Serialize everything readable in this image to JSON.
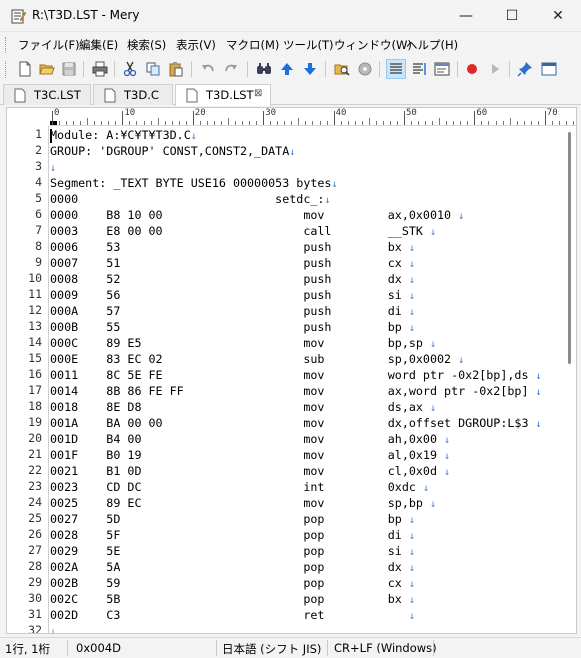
{
  "window": {
    "title": "R:\\T3D.LST - Mery",
    "minimize_glyph": "—",
    "maximize_glyph": "☐",
    "close_glyph": "✕"
  },
  "menu": [
    {
      "label": "ファイル(F)"
    },
    {
      "label": "編集(E)"
    },
    {
      "label": "検索(S)"
    },
    {
      "label": "表示(V)"
    },
    {
      "label": "マクロ(M)"
    },
    {
      "label": "ツール(T)"
    },
    {
      "label": "ウィンドウ(W)"
    },
    {
      "label": "ヘルプ(H)"
    }
  ],
  "toolbar": {
    "icons": [
      "new-file-icon",
      "open-folder-icon",
      "save-icon",
      "print-icon",
      "cut-icon",
      "copy-icon",
      "paste-icon",
      "undo-icon",
      "redo-icon",
      "find-icon",
      "find-up-icon",
      "find-down-icon",
      "search-files-icon",
      "disc-icon",
      "wrap-none-icon",
      "wrap-window-icon",
      "wrap-column-icon",
      "record-macro-icon",
      "run-macro-icon",
      "pin-icon",
      "window-icon"
    ]
  },
  "tabs": [
    {
      "label": "T3C.LST",
      "active": false
    },
    {
      "label": "T3D.C",
      "active": false
    },
    {
      "label": "T3D.LST",
      "active": true,
      "close_glyph": "⊠"
    }
  ],
  "ruler": {
    "labels": [
      "0",
      "10",
      "20",
      "30",
      "40",
      "50",
      "60",
      "70"
    ]
  },
  "editor": {
    "eol_glyph": "↓",
    "lines": [
      {
        "num": "1",
        "text": "Module: A:¥C¥T¥T3D.C",
        "eol": true
      },
      {
        "num": "2",
        "text": "GROUP: 'DGROUP' CONST,CONST2,_DATA",
        "eol": true
      },
      {
        "num": "3",
        "text": "",
        "eol": true
      },
      {
        "num": "4",
        "text": "Segment: _TEXT BYTE USE16 00000053 bytes",
        "eol": true
      },
      {
        "num": "5",
        "text": "0000                            setdc_:",
        "eol": true
      },
      {
        "num": "6",
        "text": "0000    B8 10 00                    mov         ax,0x0010 ",
        "eol": true
      },
      {
        "num": "7",
        "text": "0003    E8 00 00                    call        __STK ",
        "eol": true
      },
      {
        "num": "8",
        "text": "0006    53                          push        bx ",
        "eol": true
      },
      {
        "num": "9",
        "text": "0007    51                          push        cx ",
        "eol": true
      },
      {
        "num": "10",
        "text": "0008    52                          push        dx ",
        "eol": true
      },
      {
        "num": "11",
        "text": "0009    56                          push        si ",
        "eol": true
      },
      {
        "num": "12",
        "text": "000A    57                          push        di ",
        "eol": true
      },
      {
        "num": "13",
        "text": "000B    55                          push        bp ",
        "eol": true
      },
      {
        "num": "14",
        "text": "000C    89 E5                       mov         bp,sp ",
        "eol": true
      },
      {
        "num": "15",
        "text": "000E    83 EC 02                    sub         sp,0x0002 ",
        "eol": true
      },
      {
        "num": "16",
        "text": "0011    8C 5E FE                    mov         word ptr -0x2[bp],ds ",
        "eol": true
      },
      {
        "num": "17",
        "text": "0014    8B 86 FE FF                 mov         ax,word ptr -0x2[bp] ",
        "eol": true
      },
      {
        "num": "18",
        "text": "0018    8E D8                       mov         ds,ax ",
        "eol": true
      },
      {
        "num": "19",
        "text": "001A    BA 00 00                    mov         dx,offset DGROUP:L$3 ",
        "eol": true
      },
      {
        "num": "20",
        "text": "001D    B4 00                       mov         ah,0x00 ",
        "eol": true
      },
      {
        "num": "21",
        "text": "001F    B0 19                       mov         al,0x19 ",
        "eol": true
      },
      {
        "num": "22",
        "text": "0021    B1 0D                       mov         cl,0x0d ",
        "eol": true
      },
      {
        "num": "23",
        "text": "0023    CD DC                       int         0xdc ",
        "eol": true
      },
      {
        "num": "24",
        "text": "0025    89 EC                       mov         sp,bp ",
        "eol": true
      },
      {
        "num": "25",
        "text": "0027    5D                          pop         bp ",
        "eol": true
      },
      {
        "num": "26",
        "text": "0028    5F                          pop         di ",
        "eol": true
      },
      {
        "num": "27",
        "text": "0029    5E                          pop         si ",
        "eol": true
      },
      {
        "num": "28",
        "text": "002A    5A                          pop         dx ",
        "eol": true
      },
      {
        "num": "29",
        "text": "002B    59                          pop         cx ",
        "eol": true
      },
      {
        "num": "30",
        "text": "002C    5B                          pop         bx ",
        "eol": true
      },
      {
        "num": "31",
        "text": "002D    C3                          ret            ",
        "eol": true
      },
      {
        "num": "32",
        "text": "",
        "eol": true
      }
    ]
  },
  "status": {
    "position": "1行, 1桁",
    "code": "0x004D",
    "encoding": "日本語 (シフト JIS)",
    "newline": "CR+LF (Windows)"
  },
  "colors": {
    "eol_marker": "#3b7bd1",
    "record_macro": "#e0252b",
    "arrow_blue": "#1e6fd9"
  }
}
